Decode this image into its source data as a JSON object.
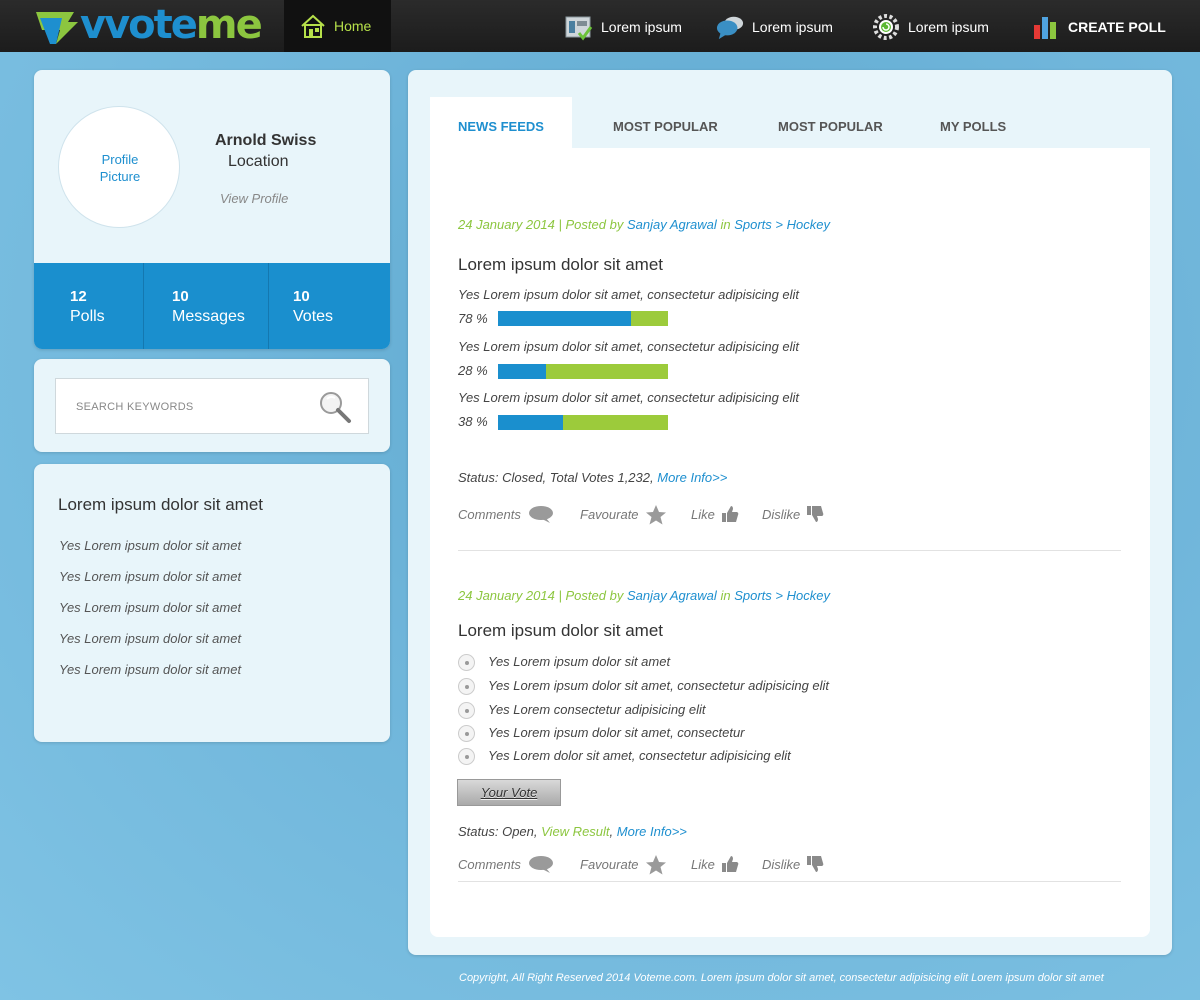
{
  "brand": {
    "logo_prefix": "v",
    "logo_main": "vote",
    "logo_suffix": "me"
  },
  "nav": {
    "home": "Home",
    "items": [
      "Lorem ipsum",
      "Lorem ipsum",
      "Lorem ipsum"
    ],
    "create_poll": "CREATE POLL"
  },
  "profile": {
    "picture_line1": "Profile",
    "picture_line2": "Picture",
    "name": "Arnold Swiss",
    "location": "Location",
    "view_profile": "View Profile",
    "stats": [
      {
        "value": "12",
        "label": "Polls"
      },
      {
        "value": "10",
        "label": "Messages"
      },
      {
        "value": "10",
        "label": "Votes"
      }
    ]
  },
  "search": {
    "placeholder": "SEARCH KEYWORDS"
  },
  "side_list": {
    "title": "Lorem ipsum dolor sit amet",
    "items": [
      "Yes Lorem ipsum dolor sit amet",
      "Yes Lorem ipsum dolor sit amet",
      "Yes Lorem ipsum dolor sit amet",
      "Yes Lorem ipsum dolor sit amet",
      "Yes Lorem ipsum dolor sit amet"
    ]
  },
  "tabs": [
    "NEWS FEEDS",
    "MOST POPULAR",
    "MOST POPULAR",
    "MY POLLS"
  ],
  "posts": [
    {
      "date": "24 January 2014",
      "sep": "|",
      "posted_by": "Posted by",
      "author": "Sanjay Agrawal",
      "in": "in",
      "category": "Sports",
      "arrow": ">",
      "subcategory": "Hockey",
      "title": "Lorem ipsum dolor sit amet",
      "results": [
        {
          "text": "Yes Lorem ipsum dolor sit amet, consectetur adipisicing elit",
          "percent_label": "78 %",
          "percent": 78
        },
        {
          "text": "Yes Lorem ipsum dolor sit amet, consectetur adipisicing elit",
          "percent_label": "28 %",
          "percent": 28
        },
        {
          "text": "Yes Lorem ipsum dolor sit amet, consectetur adipisicing elit",
          "percent_label": "38 %",
          "percent": 38
        }
      ],
      "status_prefix": "Status: Closed, Total Votes 1,232,",
      "more_info": "More Info>>"
    },
    {
      "date": "24 January 2014",
      "sep": "|",
      "posted_by": "Posted by",
      "author": "Sanjay Agrawal",
      "in": "in",
      "category": "Sports",
      "arrow": ">",
      "subcategory": "Hockey",
      "title": "Lorem ipsum dolor sit amet",
      "options": [
        "Yes Lorem ipsum dolor sit amet",
        "Yes Lorem ipsum dolor sit amet, consectetur adipisicing elit",
        "Yes Lorem consectetur adipisicing elit",
        "Yes Lorem ipsum dolor sit amet, consectetur",
        "Yes Lorem dolor sit amet, consectetur adipisicing elit"
      ],
      "vote_button": "Your Vote",
      "status_prefix": "Status: Open,",
      "view_result": "View Result",
      "comma": ",",
      "more_info": "More Info>>"
    }
  ],
  "actions": {
    "comments": "Comments",
    "favourite": "Favourate",
    "like": "Like",
    "dislike": "Dislike"
  },
  "colors": {
    "blue": "#1a8fce",
    "green": "#8cc63f",
    "dark": "#1c1c1c"
  },
  "footer": "Copyright, All Right Reserved 2014 Voteme.com. Lorem ipsum dolor sit amet, consectetur adipisicing elit Lorem ipsum dolor sit amet"
}
